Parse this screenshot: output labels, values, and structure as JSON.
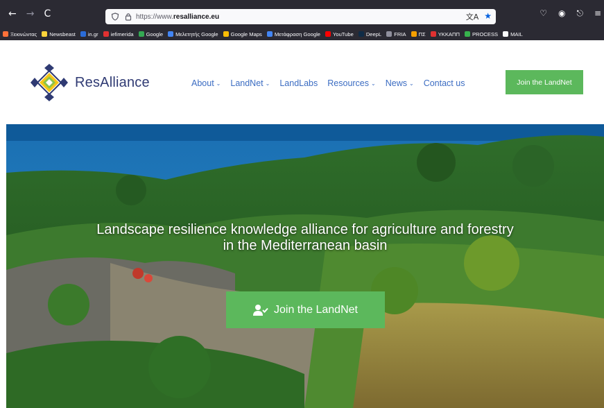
{
  "browser": {
    "url_protocol": "https://www.",
    "url_host": "resalliance.eu",
    "nav": {
      "back": "←",
      "forward": "→",
      "reload": "C"
    },
    "bookmarks": [
      {
        "label": "Ξεκινώντας",
        "color": "#ff7139"
      },
      {
        "label": "Newsbeast",
        "color": "#ffd43b"
      },
      {
        "label": "in.gr",
        "color": "#2b6cd8"
      },
      {
        "label": "iefimerida",
        "color": "#e03131"
      },
      {
        "label": "Google",
        "color": "#34a853"
      },
      {
        "label": "Μελετητής Google",
        "color": "#4285f4"
      },
      {
        "label": "Google Maps",
        "color": "#fbbc05"
      },
      {
        "label": "Μετάφραση Google",
        "color": "#4285f4"
      },
      {
        "label": "YouTube",
        "color": "#ff0000"
      },
      {
        "label": "DeepL",
        "color": "#0f2b46"
      },
      {
        "label": "FRIA",
        "color": "#8f8f9d"
      },
      {
        "label": "ΠΣ",
        "color": "#f59f00"
      },
      {
        "label": "ΥΚΚΑΠΠ",
        "color": "#e03131"
      },
      {
        "label": "PROCESS",
        "color": "#37b24d"
      },
      {
        "label": "MAIL",
        "color": "#fbfbfe"
      }
    ]
  },
  "site": {
    "brand": "ResAlliance",
    "menu": [
      {
        "label": "About",
        "dropdown": true
      },
      {
        "label": "LandNet",
        "dropdown": true
      },
      {
        "label": "LandLabs",
        "dropdown": false
      },
      {
        "label": "Resources",
        "dropdown": true
      },
      {
        "label": "News",
        "dropdown": true
      },
      {
        "label": "Contact us",
        "dropdown": false
      }
    ],
    "join_top": "Join the LandNet"
  },
  "hero": {
    "title_line1": "Landscape resilience knowledge alliance for agriculture and forestry",
    "title_line2": "in the Mediterranean basin",
    "button": "Join the LandNet"
  },
  "colors": {
    "brand_text": "#2f3a73",
    "menu_text": "#3b6cc2",
    "accent_green": "#5cb85c",
    "chrome_bg": "#2b2a33"
  }
}
